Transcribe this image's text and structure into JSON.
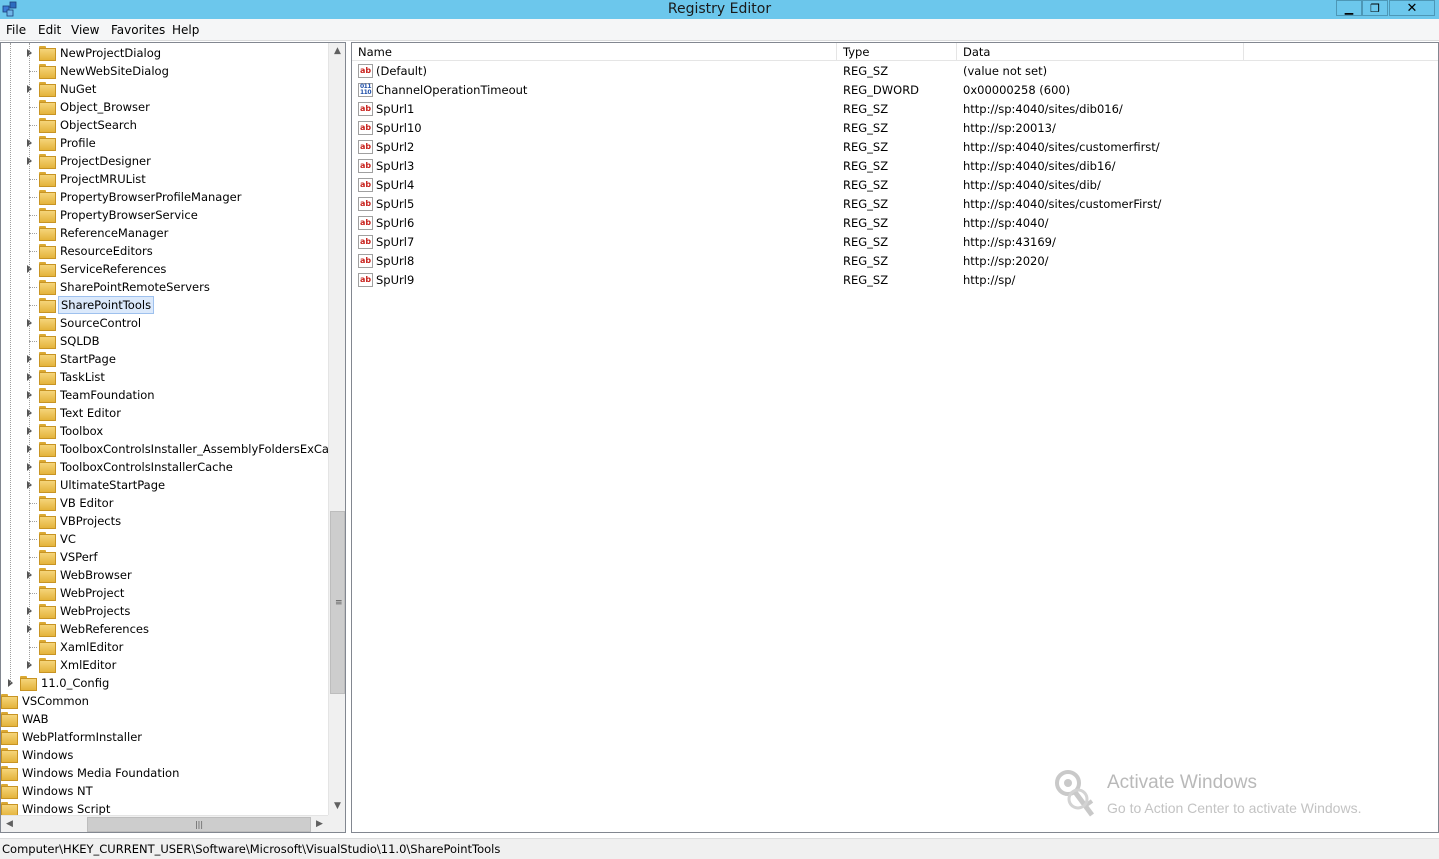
{
  "window": {
    "title": "Registry Editor",
    "min_glyph": "▁",
    "max_glyph": "❐",
    "close_glyph": "✕"
  },
  "menu": [
    "File",
    "Edit",
    "View",
    "Favorites",
    "Help"
  ],
  "tree": {
    "items": [
      {
        "label": "NewProjectDialog",
        "expander": true,
        "level": 2
      },
      {
        "label": "NewWebSiteDialog",
        "expander": false,
        "level": 2
      },
      {
        "label": "NuGet",
        "expander": true,
        "level": 2
      },
      {
        "label": "Object_Browser",
        "expander": false,
        "level": 2
      },
      {
        "label": "ObjectSearch",
        "expander": false,
        "level": 2
      },
      {
        "label": "Profile",
        "expander": true,
        "level": 2
      },
      {
        "label": "ProjectDesigner",
        "expander": true,
        "level": 2
      },
      {
        "label": "ProjectMRUList",
        "expander": false,
        "level": 2
      },
      {
        "label": "PropertyBrowserProfileManager",
        "expander": false,
        "level": 2
      },
      {
        "label": "PropertyBrowserService",
        "expander": false,
        "level": 2
      },
      {
        "label": "ReferenceManager",
        "expander": false,
        "level": 2
      },
      {
        "label": "ResourceEditors",
        "expander": false,
        "level": 2
      },
      {
        "label": "ServiceReferences",
        "expander": true,
        "level": 2
      },
      {
        "label": "SharePointRemoteServers",
        "expander": false,
        "level": 2
      },
      {
        "label": "SharePointTools",
        "expander": false,
        "level": 2,
        "selected": true
      },
      {
        "label": "SourceControl",
        "expander": true,
        "level": 2
      },
      {
        "label": "SQLDB",
        "expander": false,
        "level": 2
      },
      {
        "label": "StartPage",
        "expander": true,
        "level": 2
      },
      {
        "label": "TaskList",
        "expander": true,
        "level": 2
      },
      {
        "label": "TeamFoundation",
        "expander": true,
        "level": 2
      },
      {
        "label": "Text Editor",
        "expander": true,
        "level": 2
      },
      {
        "label": "Toolbox",
        "expander": true,
        "level": 2
      },
      {
        "label": "ToolboxControlsInstaller_AssemblyFoldersExCache",
        "expander": true,
        "level": 2
      },
      {
        "label": "ToolboxControlsInstallerCache",
        "expander": true,
        "level": 2
      },
      {
        "label": "UltimateStartPage",
        "expander": true,
        "level": 2
      },
      {
        "label": "VB Editor",
        "expander": false,
        "level": 2
      },
      {
        "label": "VBProjects",
        "expander": false,
        "level": 2
      },
      {
        "label": "VC",
        "expander": false,
        "level": 2
      },
      {
        "label": "VSPerf",
        "expander": false,
        "level": 2
      },
      {
        "label": "WebBrowser",
        "expander": true,
        "level": 2
      },
      {
        "label": "WebProject",
        "expander": false,
        "level": 2
      },
      {
        "label": "WebProjects",
        "expander": true,
        "level": 2
      },
      {
        "label": "WebReferences",
        "expander": true,
        "level": 2
      },
      {
        "label": "XamlEditor",
        "expander": false,
        "level": 2
      },
      {
        "label": "XmlEditor",
        "expander": true,
        "level": 2
      },
      {
        "label": "11.0_Config",
        "expander": true,
        "level": 1
      },
      {
        "label": "VSCommon",
        "expander": false,
        "level": 0
      },
      {
        "label": "WAB",
        "expander": false,
        "level": 0
      },
      {
        "label": "WebPlatformInstaller",
        "expander": false,
        "level": 0
      },
      {
        "label": "Windows",
        "expander": false,
        "level": 0
      },
      {
        "label": "Windows Media Foundation",
        "expander": false,
        "level": 0
      },
      {
        "label": "Windows NT",
        "expander": false,
        "level": 0
      },
      {
        "label": "Windows Script",
        "expander": false,
        "level": 0
      }
    ]
  },
  "list": {
    "columns": [
      "Name",
      "Type",
      "Data"
    ],
    "rows": [
      {
        "name": "(Default)",
        "type": "REG_SZ",
        "data": "(value not set)",
        "icon": "string-value-icon"
      },
      {
        "name": "ChannelOperationTimeout",
        "type": "REG_DWORD",
        "data": "0x00000258 (600)",
        "icon": "binary-value-icon"
      },
      {
        "name": "SpUrl1",
        "type": "REG_SZ",
        "data": "http://sp:4040/sites/dib016/",
        "icon": "string-value-icon"
      },
      {
        "name": "SpUrl10",
        "type": "REG_SZ",
        "data": "http://sp:20013/",
        "icon": "string-value-icon"
      },
      {
        "name": "SpUrl2",
        "type": "REG_SZ",
        "data": "http://sp:4040/sites/customerfirst/",
        "icon": "string-value-icon"
      },
      {
        "name": "SpUrl3",
        "type": "REG_SZ",
        "data": "http://sp:4040/sites/dib16/",
        "icon": "string-value-icon"
      },
      {
        "name": "SpUrl4",
        "type": "REG_SZ",
        "data": "http://sp:4040/sites/dib/",
        "icon": "string-value-icon"
      },
      {
        "name": "SpUrl5",
        "type": "REG_SZ",
        "data": "http://sp:4040/sites/customerFirst/",
        "icon": "string-value-icon"
      },
      {
        "name": "SpUrl6",
        "type": "REG_SZ",
        "data": "http://sp:4040/",
        "icon": "string-value-icon"
      },
      {
        "name": "SpUrl7",
        "type": "REG_SZ",
        "data": "http://sp:43169/",
        "icon": "string-value-icon"
      },
      {
        "name": "SpUrl8",
        "type": "REG_SZ",
        "data": "http://sp:2020/",
        "icon": "string-value-icon"
      },
      {
        "name": "SpUrl9",
        "type": "REG_SZ",
        "data": "http://sp/",
        "icon": "string-value-icon"
      }
    ]
  },
  "watermark": {
    "title": "Activate Windows",
    "subtitle": "Go to Action Center to activate Windows."
  },
  "status": {
    "path": "Computer\\HKEY_CURRENT_USER\\Software\\Microsoft\\VisualStudio\\11.0\\SharePointTools"
  }
}
